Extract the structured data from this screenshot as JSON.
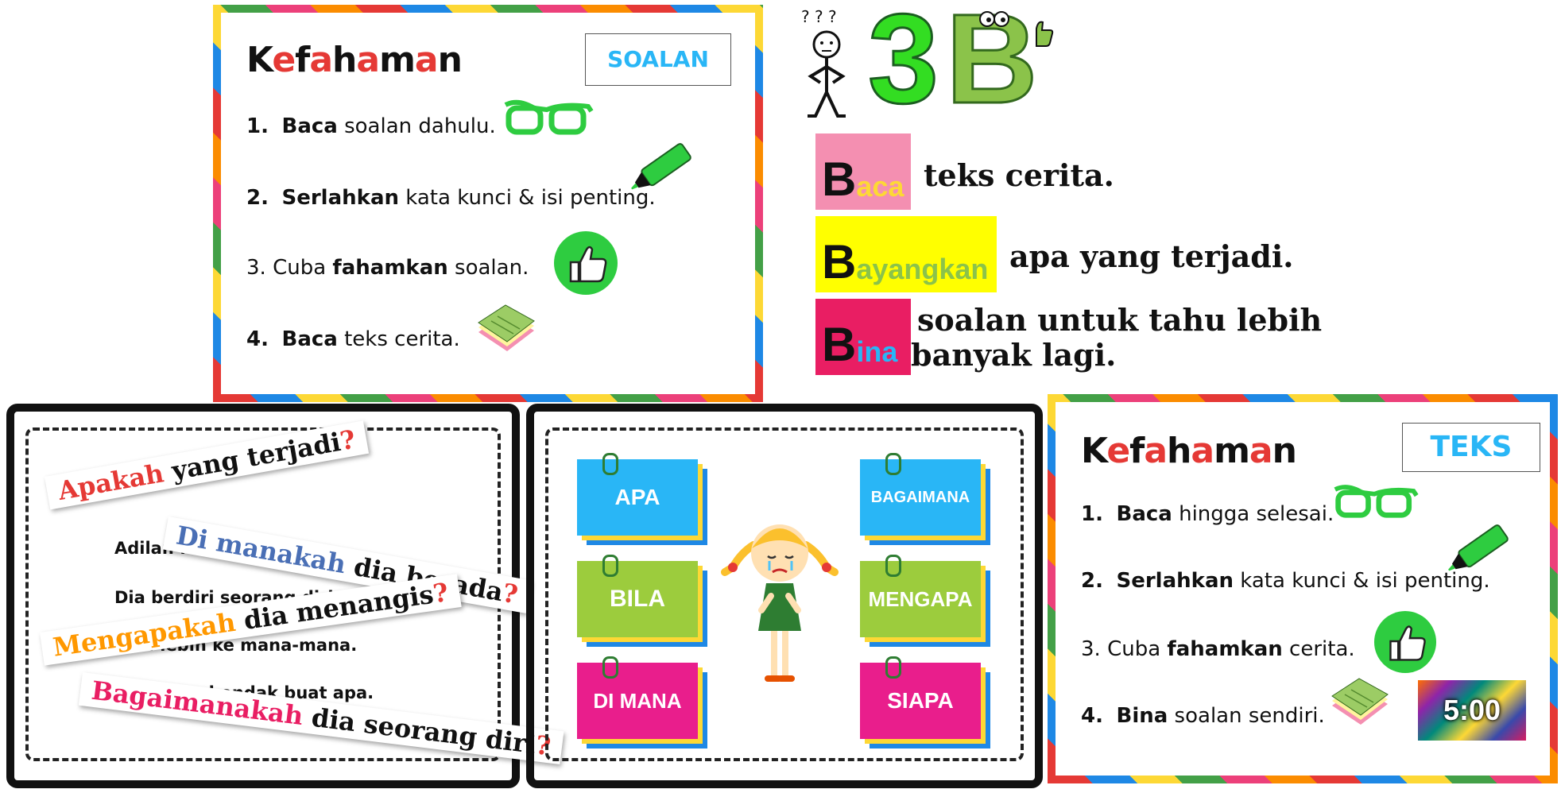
{
  "soalan_card": {
    "title": [
      {
        "ch": "K",
        "color": "#111111"
      },
      {
        "ch": "e",
        "color": "#e53935"
      },
      {
        "ch": "f",
        "color": "#111111"
      },
      {
        "ch": "a",
        "color": "#e53935"
      },
      {
        "ch": "h",
        "color": "#111111"
      },
      {
        "ch": "a",
        "color": "#e53935"
      },
      {
        "ch": "m",
        "color": "#111111"
      },
      {
        "ch": "a",
        "color": "#e53935"
      },
      {
        "ch": "n",
        "color": "#111111"
      }
    ],
    "tag": "SOALAN",
    "steps": [
      {
        "num": "1.",
        "bold_first": "Baca",
        "text": " soalan dahulu.",
        "icon": "glasses-icon"
      },
      {
        "num": "2.",
        "bold_first": "Serlahkan",
        "text": " kata kunci & isi penting.",
        "icon": "highlighter-icon"
      },
      {
        "num": "3.",
        "pre": " Cuba ",
        "bold": "fahamkan",
        "text": " soalan.",
        "icon": "thumbs-up-icon"
      },
      {
        "num": "4.",
        "bold_first": "Baca",
        "text": " teks cerita.",
        "icon": "notes-icon"
      }
    ]
  },
  "three_b": {
    "number": "3",
    "letter": "B",
    "number_color": "#33dd22",
    "letter_color": "#8bc34a",
    "rows": [
      {
        "letter": "B",
        "rest": "aca",
        "box_color": "#f48fb1",
        "rest_color": "#fdd835",
        "text": "teks cerita."
      },
      {
        "letter": "B",
        "rest": "ayangkan",
        "box_color": "#ffff00",
        "rest_color": "#8bc34a",
        "text": "apa yang terjadi."
      },
      {
        "letter": "B",
        "rest": "ina",
        "box_color": "#e91e63",
        "rest_color": "#29b6f6",
        "text_line1": "soalan untuk tahu lebih",
        "text_line2": "banyak lagi."
      }
    ]
  },
  "story_panel": {
    "lines": [
      "Adilan ...",
      "Dia berdiri seorang diri.",
      "... lebih ke mana-mana.",
      "... tahu hendak buat apa."
    ],
    "questions": [
      {
        "red": "Apakah",
        "rest": " yang terjadi",
        "mark": "?",
        "red_color": "#e53935"
      },
      {
        "red": "Di manakah",
        "rest": " dia berada",
        "mark": "?",
        "red_color": "#4a6fb5"
      },
      {
        "red": "Mengapakah",
        "rest": " dia menangis",
        "mark": "?",
        "red_color": "#ff9800"
      },
      {
        "red": "Bagaimanakah",
        "rest": " dia seorang diri",
        "mark": "?",
        "red_color": "#e91e63"
      }
    ]
  },
  "wh_panel": {
    "cards": [
      {
        "label": "APA",
        "color": "#29b6f6"
      },
      {
        "label": "BAGAIMANA",
        "color": "#29b6f6"
      },
      {
        "label": "BILA",
        "color": "#9ccc3d"
      },
      {
        "label": "MENGAPA",
        "color": "#9ccc3d"
      },
      {
        "label": "DI MANA",
        "color": "#e91e8c"
      },
      {
        "label": "SIAPA",
        "color": "#e91e8c"
      }
    ]
  },
  "teks_card": {
    "title": [
      {
        "ch": "K",
        "color": "#111111"
      },
      {
        "ch": "e",
        "color": "#e53935"
      },
      {
        "ch": "f",
        "color": "#111111"
      },
      {
        "ch": "a",
        "color": "#e53935"
      },
      {
        "ch": "h",
        "color": "#111111"
      },
      {
        "ch": "a",
        "color": "#e53935"
      },
      {
        "ch": "m",
        "color": "#111111"
      },
      {
        "ch": "a",
        "color": "#e53935"
      },
      {
        "ch": "n",
        "color": "#111111"
      }
    ],
    "tag": "TEKS",
    "steps": [
      {
        "num": "1.",
        "bold_first": "Baca",
        "text": " hingga selesai."
      },
      {
        "num": "2.",
        "bold_first": "Serlahkan",
        "text": " kata kunci & isi penting."
      },
      {
        "num": "3.",
        "pre": " Cuba ",
        "bold": "fahamkan",
        "text": " cerita."
      },
      {
        "num": "4.",
        "bold_first": "Bina",
        "text": " soalan sendiri."
      }
    ],
    "timer": "5:00"
  }
}
